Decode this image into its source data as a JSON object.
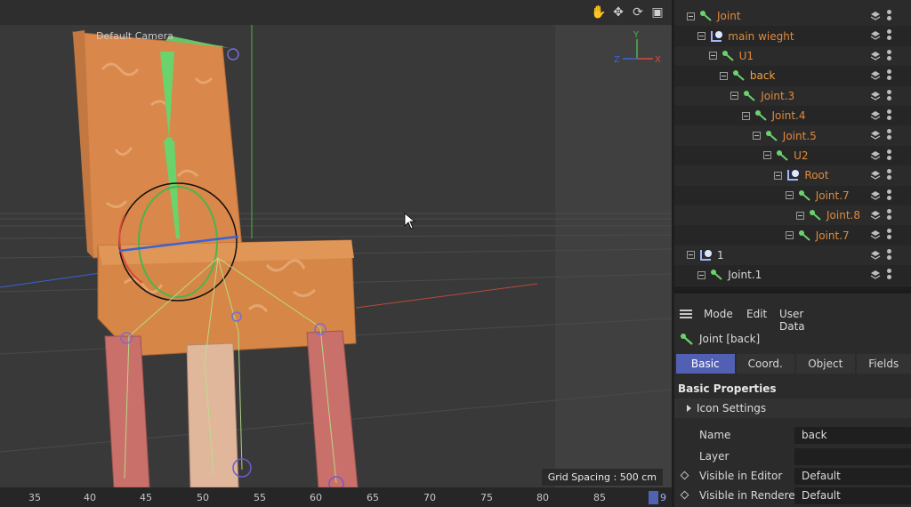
{
  "viewport": {
    "camera_label": "Default Camera",
    "grid_spacing": "Grid Spacing : 500 cm",
    "axis": {
      "x": "X",
      "y": "Y",
      "z": "Z"
    },
    "nav_icons": [
      "hand-pan-icon",
      "move-arrows-icon",
      "rotate-icon",
      "maximize-icon"
    ],
    "colors": {
      "chair_orange": "#d9874a",
      "leg_pink": "#c9706a",
      "joint_green": "#6bd36b",
      "axis_red": "#e04a3a",
      "axis_blue": "#3a63d6"
    }
  },
  "timeline": {
    "ticks": [
      "35",
      "40",
      "45",
      "50",
      "55",
      "60",
      "65",
      "70",
      "75",
      "80",
      "85"
    ],
    "current_frame_marker": "9"
  },
  "tree": {
    "rows": [
      {
        "label": "Joint",
        "icon": "joint-icon",
        "indent": 0,
        "style": "orange"
      },
      {
        "label": "main wieght",
        "icon": "null-icon",
        "indent": 1,
        "style": "orange"
      },
      {
        "label": "U1",
        "icon": "joint-icon",
        "indent": 2,
        "style": "orange"
      },
      {
        "label": "back",
        "icon": "joint-icon",
        "indent": 3,
        "style": "selected"
      },
      {
        "label": "Joint.3",
        "icon": "joint-icon",
        "indent": 4,
        "style": "orange"
      },
      {
        "label": "Joint.4",
        "icon": "joint-icon",
        "indent": 5,
        "style": "orange"
      },
      {
        "label": "Joint.5",
        "icon": "joint-icon",
        "indent": 6,
        "style": "orange"
      },
      {
        "label": "U2",
        "icon": "joint-icon",
        "indent": 7,
        "style": "orange"
      },
      {
        "label": "Root",
        "icon": "null-icon",
        "indent": 8,
        "style": "orange"
      },
      {
        "label": "Joint.7",
        "icon": "joint-icon",
        "indent": 9,
        "style": "orange"
      },
      {
        "label": "Joint.8",
        "icon": "joint-icon",
        "indent": 10,
        "style": "orange"
      },
      {
        "label": "Joint.7",
        "icon": "joint-icon",
        "indent": 9,
        "style": "orange"
      },
      {
        "label": "1",
        "icon": "null-icon",
        "indent": 0,
        "style": "white"
      },
      {
        "label": "Joint.1",
        "icon": "joint-icon",
        "indent": 1,
        "style": "white"
      }
    ]
  },
  "attributes": {
    "menu": [
      "Mode",
      "Edit",
      "User Data"
    ],
    "object_title": "Joint [back]",
    "tabs": [
      {
        "label": "Basic",
        "active": true
      },
      {
        "label": "Coord.",
        "active": false
      },
      {
        "label": "Object",
        "active": false
      },
      {
        "label": "Fields",
        "active": false
      }
    ],
    "section_title": "Basic Properties",
    "icon_settings": "Icon Settings",
    "props": [
      {
        "label": "Name",
        "value": "back",
        "diamond": false
      },
      {
        "label": "Layer",
        "value": "",
        "diamond": false
      },
      {
        "label": "Visible in Editor",
        "value": "Default",
        "diamond": true
      },
      {
        "label": "Visible in Renderer",
        "value": "Default",
        "diamond": true
      }
    ]
  }
}
